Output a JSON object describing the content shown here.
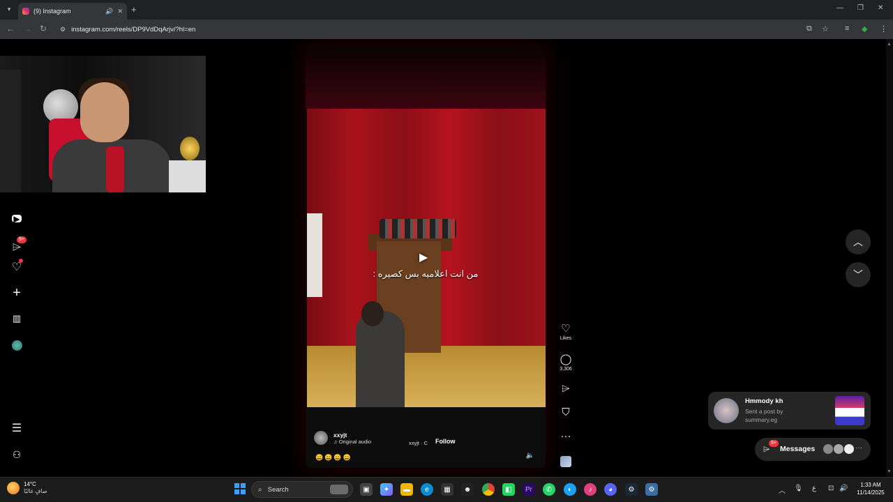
{
  "browser": {
    "tab_title": "(9) Instagram",
    "address": "instagram.com/reels/DP9VdDqArjv/?hl=en"
  },
  "sidebar": {
    "notifications_badge": "9+"
  },
  "reel": {
    "caption": "من انت اعلاميه بس كصيره :",
    "username": "xxyjt",
    "audio": "♫ Original audio",
    "collab": "xxyjt · C",
    "follow_label": "Follow",
    "emojis": "😄😄😄😄"
  },
  "actions": {
    "likes_label": "Likes",
    "comments_count": "3,306"
  },
  "notification": {
    "name": "Hmmody kh",
    "line1": "Sent a post by",
    "line2": "summary.eg"
  },
  "messages": {
    "label": "Messages",
    "badge": "9+"
  },
  "taskbar": {
    "temperature": "14°C",
    "weather_desc": "صافٍ غالبًا",
    "search_label": "Search",
    "lang": "ع",
    "time": "1:33 AM",
    "date": "11/14/2025"
  },
  "colors": {
    "accent_red": "#ff3040",
    "surface": "#262626"
  }
}
